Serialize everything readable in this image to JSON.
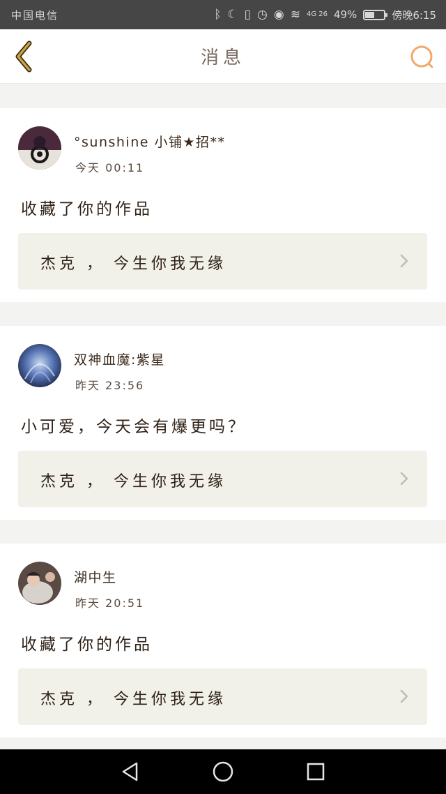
{
  "status_bar": {
    "carrier": "中国电信",
    "network": "4G 26",
    "battery": "49%",
    "battery_level": 0.49,
    "time": "傍晚6:15"
  },
  "header": {
    "title": "消息"
  },
  "messages": [
    {
      "user": "°sunshine 小铺★招**",
      "time": "今天 00:11",
      "text": "收藏了你的作品",
      "work_title": "杰克 ， 今生你我无缘"
    },
    {
      "user": "双神血魔:紫星",
      "time": "昨天 23:56",
      "text": "小可爱，今天会有爆更吗？",
      "work_title": "杰克 ， 今生你我无缘"
    },
    {
      "user": "湖中生",
      "time": "昨天 20:51",
      "text": "收藏了你的作品",
      "work_title": "杰克 ， 今生你我无缘"
    }
  ],
  "icons": {
    "back": "chevron-left-icon",
    "search": "search-icon",
    "nav_back": "triangle-back-icon",
    "nav_home": "circle-home-icon",
    "nav_recent": "square-recent-icon"
  },
  "colors": {
    "accent": "#f0a96b",
    "back_icon": "#c9a43a",
    "card_box": "#f2f1e9"
  }
}
